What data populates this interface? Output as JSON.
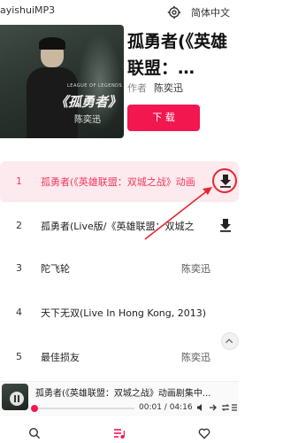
{
  "topbar": {
    "app_title": "ayishuiMP3",
    "lang_label": "简体中文"
  },
  "album": {
    "title": "孤勇者(《英雄联盟：…",
    "author_label": "作者",
    "author_name": "陈奕迅",
    "download_label": "下 载",
    "cover_small": "LEAGUE OF LEGENDS",
    "cover_title": "《孤勇者》",
    "cover_artist": "陈奕迅"
  },
  "tracks": [
    {
      "num": "1",
      "name": "孤勇者(《英雄联盟：双城之战》动画",
      "artist": ""
    },
    {
      "num": "2",
      "name": "孤勇者(Live版/《英雄联盟：双城之",
      "artist": ""
    },
    {
      "num": "3",
      "name": "陀飞轮",
      "artist": "陈奕迅"
    },
    {
      "num": "4",
      "name": "天下无双(Live In Hong Kong, 2013)",
      "artist": ""
    },
    {
      "num": "5",
      "name": "最佳损友",
      "artist": "陈奕迅"
    }
  ],
  "player": {
    "title": "孤勇者(《英雄联盟：双城之战》动画剧集中...",
    "time": "00:01 / 04:16",
    "progress": 0.004
  },
  "icons": {
    "settings": "gear-icon",
    "download": "download-icon",
    "search": "search-icon",
    "playlist": "playlist-icon",
    "favorite": "heart-icon"
  },
  "colors": {
    "accent": "#f2174f",
    "highlight_bg": "#fdeaee",
    "annotation": "#e8262f"
  }
}
